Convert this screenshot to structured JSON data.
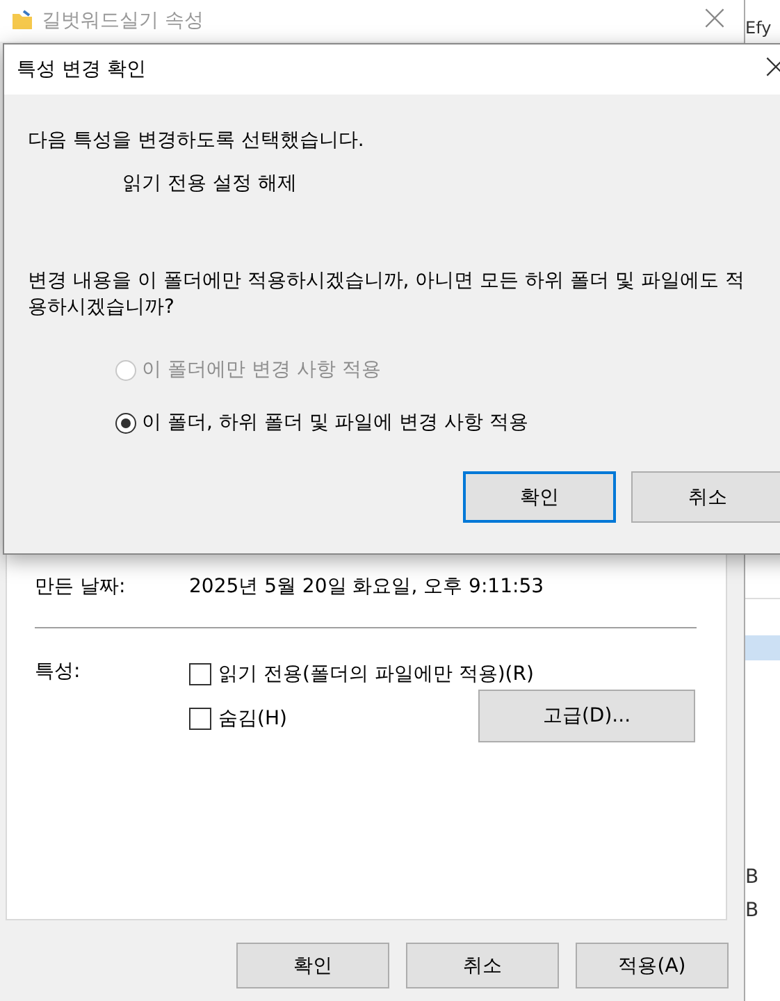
{
  "window": {
    "title": "길벗워드실기 속성"
  },
  "general": {
    "created_label": "만든 날짜:",
    "created_value": "2025년 5월 20일 화요일, 오후 9:11:53",
    "attributes_label": "특성:",
    "attributes": [
      {
        "label": "읽기 전용(폴더의 파일에만 적용)(R)",
        "checked": false
      },
      {
        "label": "숨김(H)",
        "checked": false
      }
    ],
    "advanced_button": "고급(D)..."
  },
  "buttons": [
    "확인",
    "취소",
    "적용(A)"
  ],
  "dialog": {
    "title": "특성 변경 확인",
    "message": "다음 특성을 변경하도록 선택했습니다.",
    "change": "읽기 전용 설정 해제",
    "question": "변경 내용을 이 폴더에만 적용하시겠습니까, 아니면 모든 하위 폴더 및 파일에도 적용하시겠습니까?",
    "options": [
      {
        "label": "이 폴더에만 변경 사항 적용",
        "selected": false,
        "disabled": true
      },
      {
        "label": "이 폴더, 하위 폴더 및 파일에 변경 사항 적용",
        "selected": true,
        "disabled": false
      }
    ],
    "buttons": [
      {
        "label": "확인",
        "default": true
      },
      {
        "label": "취소",
        "default": false
      }
    ]
  },
  "background_window": {
    "texts": [
      "Efy",
      "B",
      "B"
    ]
  }
}
